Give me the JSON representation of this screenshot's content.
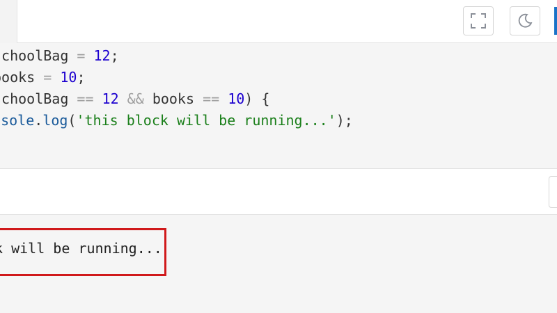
{
  "toolbar": {
    "fullscreen_icon": "fullscreen-icon",
    "theme_icon": "moon-icon",
    "accent_color": "#1a73c8"
  },
  "code": {
    "line1": {
      "ident": "schoolBag",
      "op": " = ",
      "num": "12",
      "end": ";"
    },
    "line2": {
      "ident": "books",
      "op": " = ",
      "num": "10",
      "end": ";"
    },
    "line3": {
      "a": "schoolBag",
      "op1": " == ",
      "n1": "12",
      "and": " && ",
      "b": "books",
      "op2": " == ",
      "n2": "10",
      "end": ") {"
    },
    "line4": {
      "obj": "onsole",
      "dot": ".",
      "fn": "log",
      "open": "(",
      "str": "'this block will be running...'",
      "close": ");"
    }
  },
  "console": {
    "output": "k will be running...",
    "highlight_color": "#d0191b"
  }
}
